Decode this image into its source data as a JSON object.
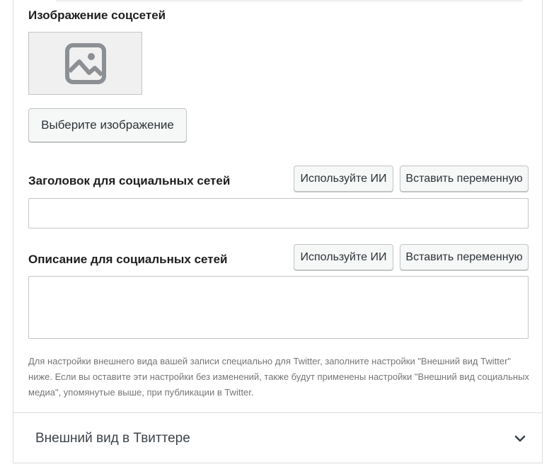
{
  "social_image": {
    "label": "Изображение соцсетей",
    "select_button": "Выберите изображение",
    "placeholder_icon": "image-placeholder-icon"
  },
  "social_title": {
    "label": "Заголовок для социальных сетей",
    "ai_button": "Используйте ИИ",
    "variable_button": "Вставить переменную",
    "value": ""
  },
  "social_description": {
    "label": "Описание для социальных сетей",
    "ai_button": "Используйте ИИ",
    "variable_button": "Вставить переменную",
    "value": ""
  },
  "help_text": "Для настройки внешнего вида вашей записи специально для Twitter, заполните настройки \"Внешний вид Twitter\" ниже. Если вы оставите эти настройки без изменений, также будут применены настройки \"Внешний вид социальных медиа\", упомянутые выше, при публикации в Twitter.",
  "twitter_accordion": {
    "title": "Внешний вид в Твиттере",
    "icon": "chevron-down-icon",
    "expanded": false
  },
  "colors": {
    "border": "#c3c4c7",
    "button_bg": "#f6f7f7",
    "placeholder_bg": "#f0f0f0",
    "icon_gray": "#8c8f94",
    "help_text": "#757575"
  }
}
